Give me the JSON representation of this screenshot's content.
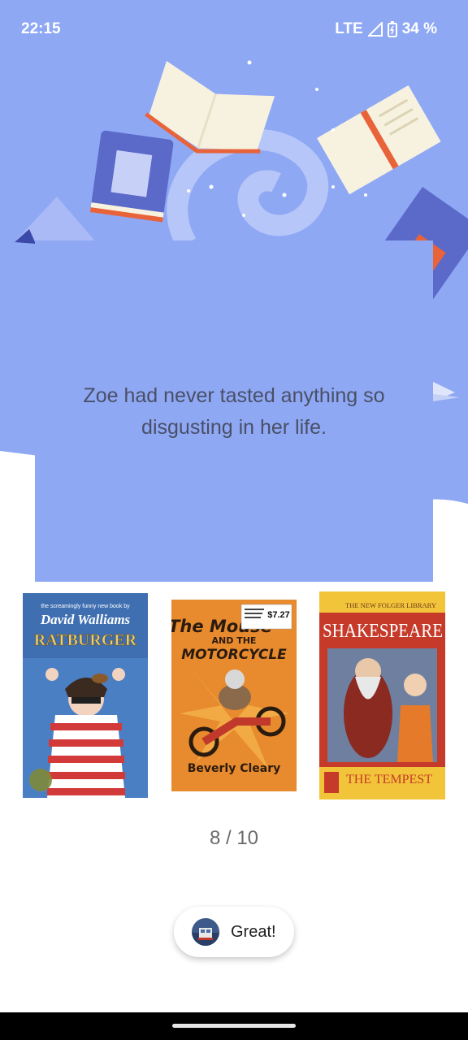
{
  "status_bar": {
    "time": "22:15",
    "network": "LTE",
    "battery": "34 %"
  },
  "colors": {
    "hero_background": "#8ea8f4",
    "card_background": "#8ea8f4",
    "quote_text": "#4a4f66",
    "page_indicator": "#6b6b6b"
  },
  "quote": {
    "text": "Zoe had never tasted anything so disgusting in her life."
  },
  "books": [
    {
      "title": "RATBURGER",
      "author": "David Walliams",
      "tagline": "the screamingly funny new book by"
    },
    {
      "title": "The Mouse and the Motorcycle",
      "title_line1": "The Mouse",
      "title_line2": "AND THE",
      "title_line3": "MOTORCYCLE",
      "author": "Beverly Cleary",
      "price": "$7.27"
    },
    {
      "series": "THE NEW FOLGER LIBRARY",
      "author": "SHAKESPEARE",
      "title": "THE TEMPEST"
    }
  ],
  "pagination": {
    "label": "8 / 10"
  },
  "action": {
    "label": "Great!",
    "avatar_icon": "user-avatar-icon"
  }
}
